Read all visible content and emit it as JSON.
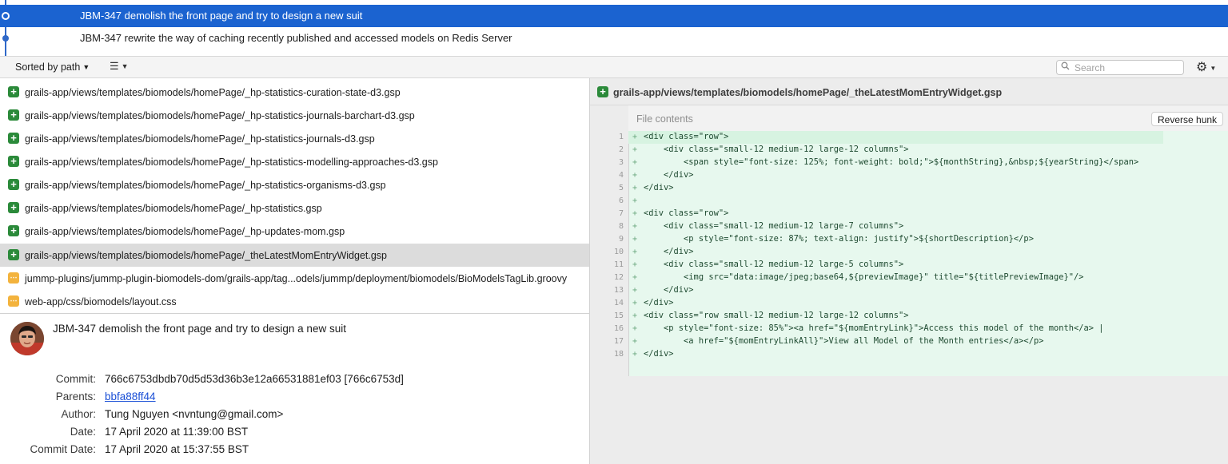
{
  "commits": [
    {
      "message": "JBM-347 demolish the front page and try to design a new suit",
      "selected": true
    },
    {
      "message": "JBM-347 rewrite the way of caching recently published and accessed models on Redis Server",
      "selected": false
    }
  ],
  "toolbar": {
    "sort_label": "Sorted by path",
    "search_placeholder": "Search"
  },
  "files": [
    {
      "path": "grails-app/views/templates/biomodels/homePage/_hp-statistics-curation-state-d3.gsp",
      "status": "added",
      "selected": false
    },
    {
      "path": "grails-app/views/templates/biomodels/homePage/_hp-statistics-journals-barchart-d3.gsp",
      "status": "added",
      "selected": false
    },
    {
      "path": "grails-app/views/templates/biomodels/homePage/_hp-statistics-journals-d3.gsp",
      "status": "added",
      "selected": false
    },
    {
      "path": "grails-app/views/templates/biomodels/homePage/_hp-statistics-modelling-approaches-d3.gsp",
      "status": "added",
      "selected": false
    },
    {
      "path": "grails-app/views/templates/biomodels/homePage/_hp-statistics-organisms-d3.gsp",
      "status": "added",
      "selected": false
    },
    {
      "path": "grails-app/views/templates/biomodels/homePage/_hp-statistics.gsp",
      "status": "added",
      "selected": false
    },
    {
      "path": "grails-app/views/templates/biomodels/homePage/_hp-updates-mom.gsp",
      "status": "added",
      "selected": false
    },
    {
      "path": "grails-app/views/templates/biomodels/homePage/_theLatestMomEntryWidget.gsp",
      "status": "added",
      "selected": true
    },
    {
      "path": "jummp-plugins/jummp-plugin-biomodels-dom/grails-app/tag...odels/jummp/deployment/biomodels/BioModelsTagLib.groovy",
      "status": "modified",
      "selected": false
    },
    {
      "path": "web-app/css/biomodels/layout.css",
      "status": "modified",
      "selected": false
    }
  ],
  "details": {
    "subject": "JBM-347 demolish the front page and try to design a new suit",
    "commit_label": "Commit:",
    "commit_value": "766c6753dbdb70d5d53d36b3e12a66531881ef03 [766c6753d]",
    "parents_label": "Parents:",
    "parents_value": "bbfa88ff44",
    "author_label": "Author:",
    "author_value": "Tung Nguyen <nvntung@gmail.com>",
    "date_label": "Date:",
    "date_value": "17 April 2020 at 11:39:00 BST",
    "commit_date_label": "Commit Date:",
    "commit_date_value": "17 April 2020 at 15:37:55 BST"
  },
  "diff": {
    "file_path": "grails-app/views/templates/biomodels/homePage/_theLatestMomEntryWidget.gsp",
    "hunk_title": "File contents",
    "reverse_label": "Reverse hunk",
    "lines": [
      {
        "n": "1",
        "code": "<div class=\"row\">"
      },
      {
        "n": "2",
        "code": "    <div class=\"small-12 medium-12 large-12 columns\">"
      },
      {
        "n": "3",
        "code": "        <span style=\"font-size: 125%; font-weight: bold;\">${monthString},&nbsp;${yearString}</span>"
      },
      {
        "n": "4",
        "code": "    </div>"
      },
      {
        "n": "5",
        "code": "</div>"
      },
      {
        "n": "6",
        "code": ""
      },
      {
        "n": "7",
        "code": "<div class=\"row\">"
      },
      {
        "n": "8",
        "code": "    <div class=\"small-12 medium-12 large-7 columns\">"
      },
      {
        "n": "9",
        "code": "        <p style=\"font-size: 87%; text-align: justify\">${shortDescription}</p>"
      },
      {
        "n": "10",
        "code": "    </div>"
      },
      {
        "n": "11",
        "code": "    <div class=\"small-12 medium-12 large-5 columns\">"
      },
      {
        "n": "12",
        "code": "        <img src=\"data:image/jpeg;base64,${previewImage}\" title=\"${titlePreviewImage}\"/>"
      },
      {
        "n": "13",
        "code": "    </div>"
      },
      {
        "n": "14",
        "code": "</div>"
      },
      {
        "n": "15",
        "code": "<div class=\"row small-12 medium-12 large-12 columns\">"
      },
      {
        "n": "16",
        "code": "    <p style=\"font-size: 85%\"><a href=\"${momEntryLink}\">Access this model of the month</a> |"
      },
      {
        "n": "17",
        "code": "        <a href=\"${momEntryLinkAll}\">View all Model of the Month entries</a></p>"
      },
      {
        "n": "18",
        "code": "</div>"
      }
    ]
  },
  "colors": {
    "selection": "#1b63d0",
    "added": "#2b8a3a",
    "modified": "#f3b33d",
    "diff_added_bg": "#e7f8ee"
  },
  "icons": [
    "plus-badge-icon",
    "ellipsis-badge-icon",
    "search-icon",
    "gear-icon",
    "list-icon",
    "chevron-down-icon"
  ]
}
